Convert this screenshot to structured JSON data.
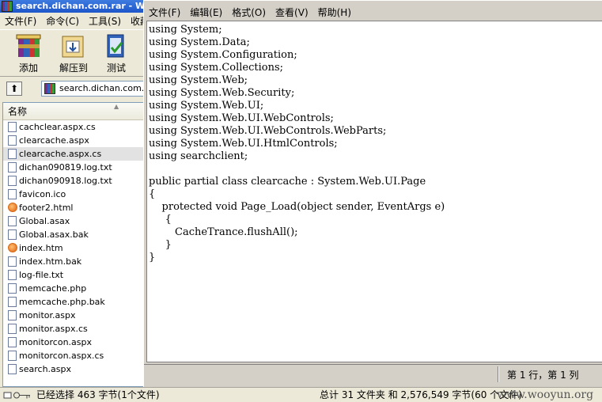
{
  "winrar": {
    "title": "search.dichan.com.rar - Win",
    "menu": [
      "文件(F)",
      "命令(C)",
      "工具(S)",
      "收藏"
    ],
    "toolbar": [
      {
        "label": "添加",
        "icon": "add-archive-icon"
      },
      {
        "label": "解压到",
        "icon": "extract-to-icon"
      },
      {
        "label": "测试",
        "icon": "test-icon"
      }
    ],
    "address": "search.dichan.com.ra",
    "column_name": "名称",
    "files": [
      {
        "name": "cachclear.aspx.cs",
        "icon": "file-icon"
      },
      {
        "name": "clearcache.aspx",
        "icon": "file-icon"
      },
      {
        "name": "clearcache.aspx.cs",
        "icon": "file-icon",
        "selected": true
      },
      {
        "name": "dichan090819.log.txt",
        "icon": "file-icon"
      },
      {
        "name": "dichan090918.log.txt",
        "icon": "file-icon"
      },
      {
        "name": "favicon.ico",
        "icon": "file-icon"
      },
      {
        "name": "footer2.html",
        "icon": "web-icon"
      },
      {
        "name": "Global.asax",
        "icon": "file-icon"
      },
      {
        "name": "Global.asax.bak",
        "icon": "file-icon"
      },
      {
        "name": "index.htm",
        "icon": "web-icon"
      },
      {
        "name": "index.htm.bak",
        "icon": "file-icon"
      },
      {
        "name": "log-file.txt",
        "icon": "file-icon"
      },
      {
        "name": "memcache.php",
        "icon": "file-icon"
      },
      {
        "name": "memcache.php.bak",
        "icon": "file-icon"
      },
      {
        "name": "monitor.aspx",
        "icon": "file-icon"
      },
      {
        "name": "monitor.aspx.cs",
        "icon": "file-icon"
      },
      {
        "name": "monitorcon.aspx",
        "icon": "file-icon"
      },
      {
        "name": "monitorcon.aspx.cs",
        "icon": "file-icon"
      },
      {
        "name": "search.aspx",
        "icon": "file-icon"
      }
    ],
    "status_left": "已经选择 463 字节(1个文件)",
    "status_right": "总计 31 文件夹 和 2,576,549 字节(60 个文件)",
    "watermark": "www.wooyun.org"
  },
  "notepad": {
    "menu": [
      "文件(F)",
      "编辑(E)",
      "格式(O)",
      "查看(V)",
      "帮助(H)"
    ],
    "content": "using System;\nusing System.Data;\nusing System.Configuration;\nusing System.Collections;\nusing System.Web;\nusing System.Web.Security;\nusing System.Web.UI;\nusing System.Web.UI.WebControls;\nusing System.Web.UI.WebControls.WebParts;\nusing System.Web.UI.HtmlControls;\nusing searchclient;\n\npublic partial class clearcache : System.Web.UI.Page\n{\n    protected void Page_Load(object sender, EventArgs e)\n     {\n        CacheTrance.flushAll();\n     }\n}",
    "cursor_position": "第 1 行，第 1 列"
  }
}
